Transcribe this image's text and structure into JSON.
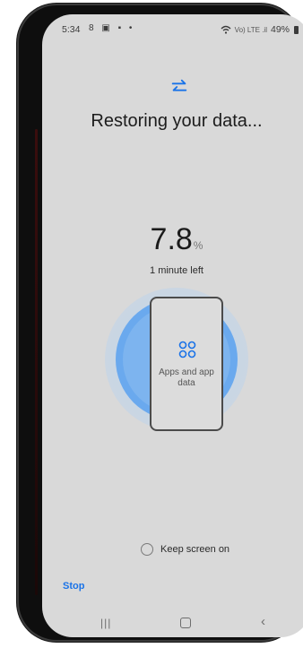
{
  "status_bar": {
    "time": "5:34",
    "left_icons": "8 ▣ ▪ •",
    "signal_text": "Vo) LTE .il",
    "battery": "49%"
  },
  "main": {
    "title": "Restoring your data...",
    "progress_number": "7.8",
    "progress_unit": "%",
    "progress_fraction": 0.078,
    "time_left": "1 minute left",
    "card_label": "Apps and app data",
    "keep_screen_on_label": "Keep screen on",
    "stop_label": "Stop"
  },
  "colors": {
    "accent": "#1a73e8",
    "ring_blue": "#6aa9ee",
    "screen_bg": "#d9d9d9"
  },
  "icons": {
    "swap": "swap-arrows-icon",
    "apps": "apps-grid-icon",
    "nav_recent": "recent-apps-icon",
    "nav_home": "home-icon",
    "nav_back": "back-icon"
  }
}
